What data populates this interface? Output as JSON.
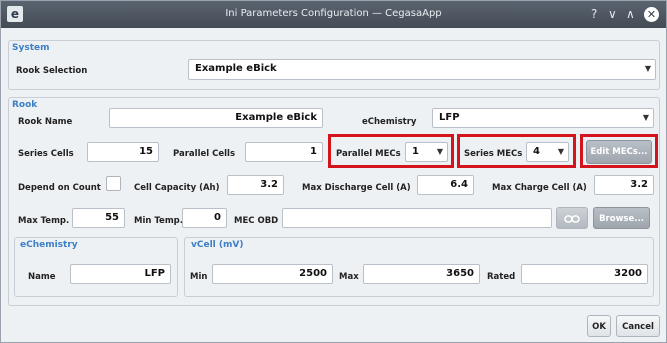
{
  "window": {
    "title": "Ini Parameters Configuration — CegasaApp",
    "app_icon": "e"
  },
  "titlebar_buttons": {
    "help": "?",
    "minimize": "∨",
    "maximize": "∧",
    "close": "✕"
  },
  "system": {
    "title": "System",
    "rook_selection_label": "Rook Selection",
    "rook_selection_value": "Example eBick"
  },
  "rook": {
    "title": "Rook",
    "name_label": "Rook Name",
    "name_value": "Example eBick",
    "echemistry_label": "eChemistry",
    "echemistry_value": "LFP",
    "series_cells_label": "Series Cells",
    "series_cells_value": "15",
    "parallel_cells_label": "Parallel Cells",
    "parallel_cells_value": "1",
    "parallel_mecs_label": "Parallel MECs",
    "parallel_mecs_value": "1",
    "series_mecs_label": "Series MECs",
    "series_mecs_value": "4",
    "edit_mecs_label": "Edit MECs...",
    "depend_on_count_label": "Depend on Count",
    "cell_capacity_label": "Cell Capacity (Ah)",
    "cell_capacity_value": "3.2",
    "max_discharge_label": "Max Discharge Cell (A)",
    "max_discharge_value": "6.4",
    "max_charge_label": "Max Charge Cell (A)",
    "max_charge_value": "3.2",
    "max_temp_label": "Max Temp.",
    "max_temp_value": "55",
    "min_temp_label": "Min Temp.",
    "min_temp_value": "0",
    "mec_obd_label": "MEC OBD",
    "mec_obd_value": "",
    "browse_label": "Browse..."
  },
  "echemistry_group": {
    "title": "eChemistry",
    "name_label": "Name",
    "name_value": "LFP"
  },
  "vcell_group": {
    "title": "vCell (mV)",
    "min_label": "Min",
    "min_value": "2500",
    "max_label": "Max",
    "max_value": "3650",
    "rated_label": "Rated",
    "rated_value": "3200"
  },
  "footer": {
    "ok_label": "OK",
    "cancel_label": "Cancel"
  },
  "colors": {
    "accent": "#3d7fc4",
    "highlight": "#d4141c",
    "titlebar": "#4a535d"
  }
}
